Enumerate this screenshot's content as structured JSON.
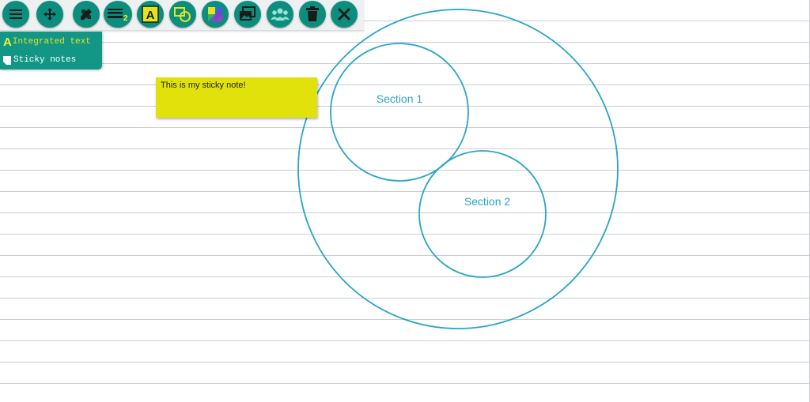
{
  "toolbar": {
    "buttons": [
      {
        "icon": "hamburger-menu-icon"
      },
      {
        "icon": "move-arrows-icon"
      },
      {
        "icon": "drawing-tools-icon"
      },
      {
        "icon": "line-width-icon",
        "badge": "2"
      },
      {
        "icon": "text-tool-icon",
        "glyph": "A"
      },
      {
        "icon": "shapes-icon"
      },
      {
        "icon": "color-palette-icon"
      },
      {
        "icon": "insert-image-icon"
      },
      {
        "icon": "users-icon"
      },
      {
        "icon": "trash-icon"
      },
      {
        "icon": "close-icon"
      }
    ]
  },
  "side_menu": {
    "items": [
      {
        "icon": "text-a-icon",
        "glyph": "A",
        "label": "Integrated text"
      },
      {
        "icon": "sticky-note-icon",
        "label": "Sticky notes"
      }
    ]
  },
  "sticky_note": {
    "text": "This is my sticky note!"
  },
  "diagram": {
    "sections": [
      {
        "label": "Section 1"
      },
      {
        "label": "Section 2"
      }
    ]
  },
  "colors": {
    "toolbar_button": "#0c8e7e",
    "menu_background": "#129786",
    "menu_highlight": "#e3e320",
    "sticky_note": "#e1e20b",
    "diagram_stroke": "#2aa4c4",
    "ruled_lines": "#c7cfd2"
  }
}
